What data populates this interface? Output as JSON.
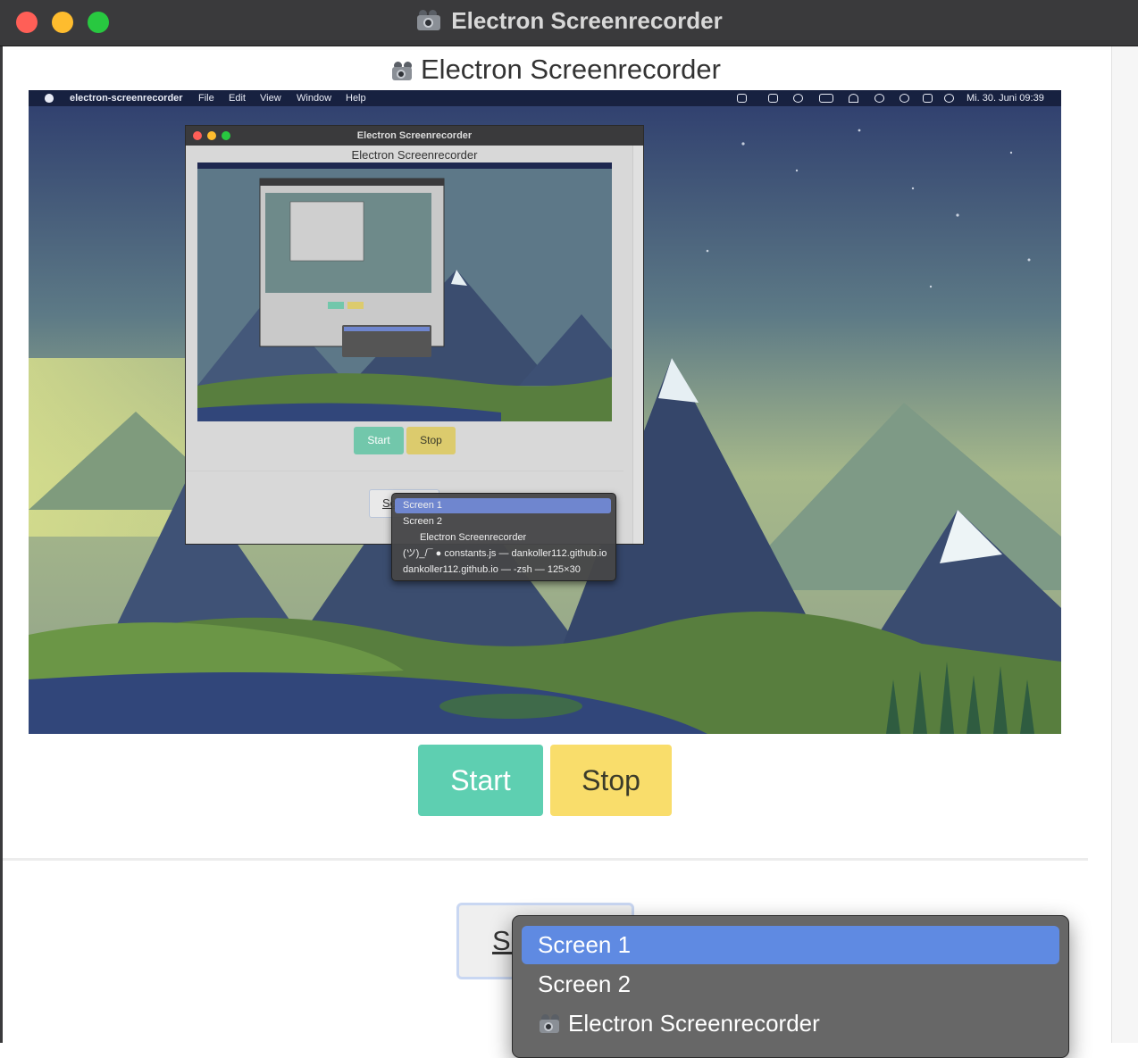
{
  "window": {
    "title": "Electron Screenrecorder",
    "traffic_lights": [
      "close",
      "minimize",
      "zoom"
    ]
  },
  "page": {
    "title": "Electron Screenrecorder",
    "title_icon": "video-camera-icon"
  },
  "preview": {
    "menubar": {
      "app_name": "electron-screenrecorder",
      "menus": [
        "File",
        "Edit",
        "View",
        "Window",
        "Help"
      ],
      "datetime": "Mi. 30. Juni 09:39"
    },
    "inner_window": {
      "title": "Electron Screenrecorder",
      "heading": "Electron Screenrecorder",
      "start_label": "Start",
      "stop_label": "Stop",
      "select_text": "Sc",
      "menu_items": [
        "Screen 1",
        "Screen 2",
        "Electron Screenrecorder",
        "(ツ)_/¯ ● constants.js — dankoller112.github.io",
        "dankoller112.github.io — -zsh — 125×30"
      ]
    }
  },
  "controls": {
    "start_label": "Start",
    "stop_label": "Stop",
    "start_color": "#5ecfb1",
    "stop_color": "#f9dd6b"
  },
  "source_select": {
    "value_text": "Sc",
    "options": [
      "Screen 1",
      "Screen 2",
      "Electron Screenrecorder"
    ],
    "selected": "Screen 1",
    "highlight_color": "#5f8ae2"
  }
}
